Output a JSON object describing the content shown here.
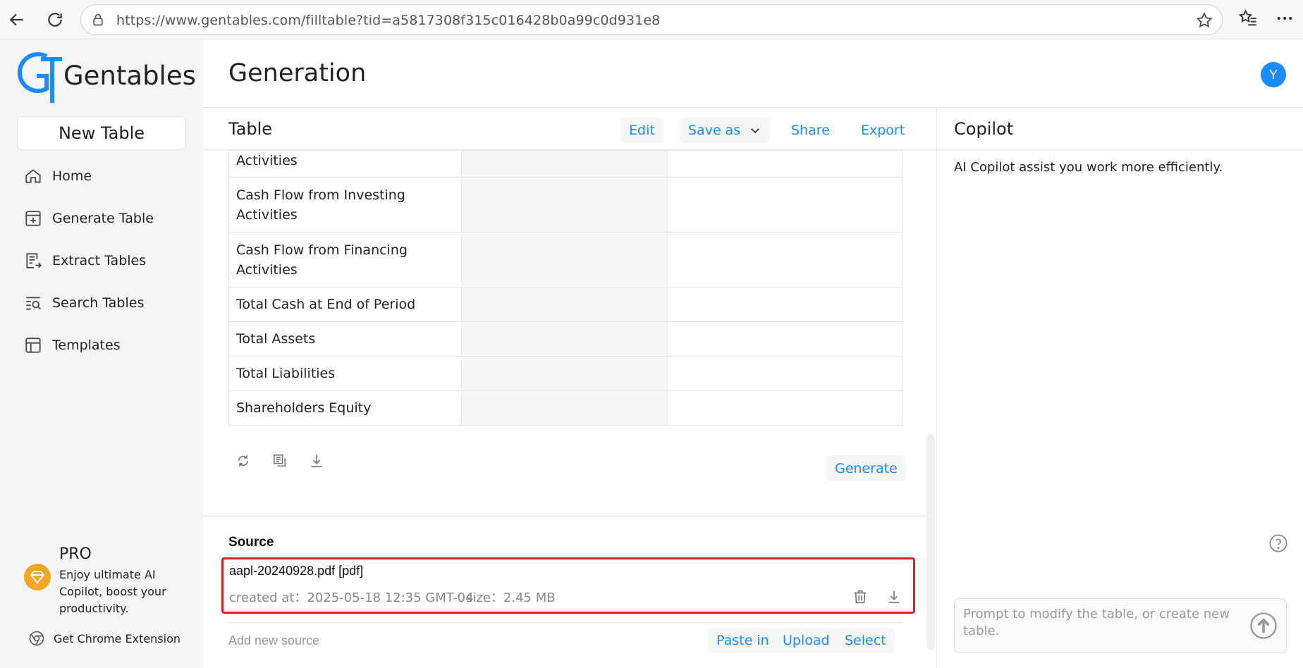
{
  "browser": {
    "url": "https://www.gentables.com/filltable?tid=a5817308f315c016428b0a99c0d931e8"
  },
  "sidebar": {
    "logo_text": "Gentables",
    "new_table": "New Table",
    "items": [
      {
        "label": "Home",
        "icon": "home-icon"
      },
      {
        "label": "Generate Table",
        "icon": "plus-square-icon"
      },
      {
        "label": "Extract Tables",
        "icon": "extract-icon"
      },
      {
        "label": "Search Tables",
        "icon": "search-list-icon"
      },
      {
        "label": "Templates",
        "icon": "template-icon"
      }
    ],
    "pro_title": "PRO",
    "pro_desc": "Enjoy ultimate AI Copilot, boost your productivity.",
    "chrome_ext": "Get Chrome Extension"
  },
  "header": {
    "title": "Generation",
    "avatar": "Y"
  },
  "table": {
    "title": "Table",
    "edit": "Edit",
    "save_as": "Save as",
    "share": "Share",
    "export": "Export",
    "rows": [
      "Activities",
      "Cash Flow from Investing Activities",
      "Cash Flow from Financing Activities",
      "Total Cash at End of Period",
      "Total Assets",
      "Total Liabilities",
      "Shareholders Equity"
    ],
    "generate": "Generate"
  },
  "source": {
    "title": "Source",
    "file_name": "aapl-20240928.pdf [pdf]",
    "created": "created at：2025-05-18 12:35 GMT-04",
    "size": "size：2.45 MB",
    "add_new": "Add new source",
    "paste_in": "Paste in",
    "upload": "Upload",
    "select": "Select"
  },
  "copilot": {
    "title": "Copilot",
    "desc": "AI Copilot assist you work more efficiently.",
    "prompt_placeholder": "Prompt to modify the table, or create new table."
  },
  "colors": {
    "accent": "#1a8cff",
    "highlight": "#e02020",
    "pro": "#f5a623"
  }
}
